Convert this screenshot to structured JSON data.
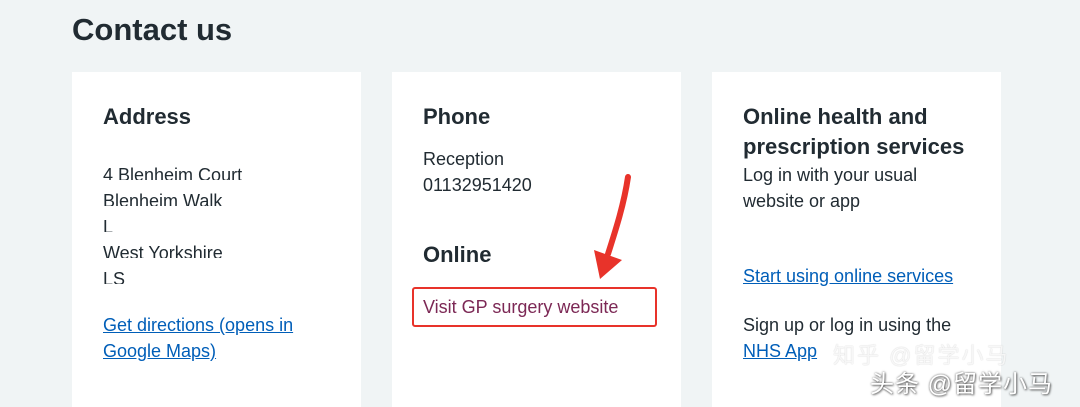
{
  "page": {
    "title": "Contact us"
  },
  "address": {
    "heading": "Address",
    "lines": [
      "4 Blenheim Court",
      "Blenheim Walk",
      "L",
      "West Yorkshire",
      "LS"
    ],
    "directions_link": "Get directions (opens in Google Maps)"
  },
  "phone": {
    "heading": "Phone",
    "reception_label": "Reception",
    "reception_number": "01132951420",
    "online_heading": "Online",
    "website_link": "Visit GP surgery website"
  },
  "online_services": {
    "heading": "Online health and prescription services",
    "login_text": "Log in with your usual website or app",
    "start_link": "Start using online services",
    "signup_text": "Sign up or log in using the",
    "nhs_app_link": "NHS App"
  },
  "watermark": {
    "line1": "知乎 @留学小马",
    "line2": "头条 @留学小马"
  },
  "colors": {
    "background": "#f0f4f5",
    "card": "#ffffff",
    "text": "#212b32",
    "link": "#005eb8",
    "visited_link": "#7c2855",
    "annotation": "#e8332a"
  }
}
